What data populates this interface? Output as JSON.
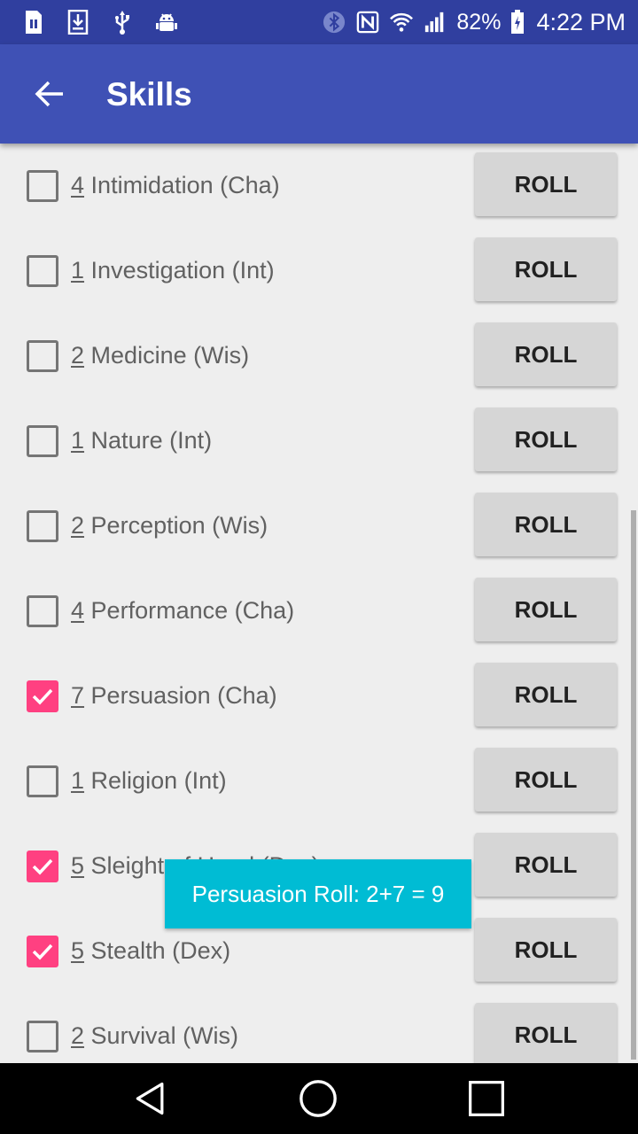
{
  "status_bar": {
    "left_icons": [
      "sim-card-icon",
      "download-icon",
      "usb-icon",
      "android-debug-icon"
    ],
    "right_icons": [
      "bluetooth-icon",
      "nfc-icon",
      "wifi-icon",
      "signal-icon",
      "battery-icon"
    ],
    "battery": "82%",
    "time": "4:22 PM"
  },
  "app_bar": {
    "back_icon": "arrow-back-icon",
    "title": "Skills"
  },
  "skills": [
    {
      "value": "4",
      "name": "Intimidation (Cha)",
      "checked": false,
      "button": "ROLL"
    },
    {
      "value": "1",
      "name": "Investigation (Int)",
      "checked": false,
      "button": "ROLL"
    },
    {
      "value": "2",
      "name": "Medicine (Wis)",
      "checked": false,
      "button": "ROLL"
    },
    {
      "value": "1",
      "name": "Nature (Int)",
      "checked": false,
      "button": "ROLL"
    },
    {
      "value": "2",
      "name": "Perception (Wis)",
      "checked": false,
      "button": "ROLL"
    },
    {
      "value": "4",
      "name": "Performance (Cha)",
      "checked": false,
      "button": "ROLL"
    },
    {
      "value": "7",
      "name": "Persuasion (Cha)",
      "checked": true,
      "button": "ROLL"
    },
    {
      "value": "1",
      "name": "Religion (Int)",
      "checked": false,
      "button": "ROLL"
    },
    {
      "value": "5",
      "name": "Sleight of Hand (Dex)",
      "checked": true,
      "button": "ROLL"
    },
    {
      "value": "5",
      "name": "Stealth (Dex)",
      "checked": true,
      "button": "ROLL"
    },
    {
      "value": "2",
      "name": "Survival (Wis)",
      "checked": false,
      "button": "ROLL"
    }
  ],
  "toast": {
    "text": "Persuasion Roll: 2+7 = 9"
  },
  "nav_bar": {
    "buttons": [
      "back-triangle-icon",
      "home-circle-icon",
      "recents-square-icon"
    ]
  },
  "colors": {
    "status_bar": "#303f9f",
    "app_bar": "#3f51b5",
    "checkbox_checked": "#ff4081",
    "toast": "#00bcd4",
    "roll_button": "#d6d6d6"
  }
}
